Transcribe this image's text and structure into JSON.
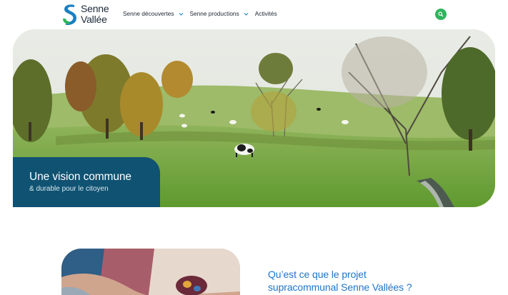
{
  "logo": {
    "line1": "Senne",
    "line2": "Vallée"
  },
  "nav": {
    "items": [
      {
        "label": "Senne découvertes",
        "has_dropdown": true
      },
      {
        "label": "Senne productions",
        "has_dropdown": true
      },
      {
        "label": "Activités",
        "has_dropdown": false
      }
    ]
  },
  "search": {
    "icon": "search-icon",
    "color": "#2fb45c"
  },
  "hero": {
    "title": "Une vision commune",
    "subtitle": "& durable pour le citoyen",
    "card_color": "#0f5272"
  },
  "project": {
    "title_line1": "Qu’est ce que le projet",
    "title_line2": "supracommunal Senne Vallées ?",
    "title_color": "#1f74c9"
  }
}
